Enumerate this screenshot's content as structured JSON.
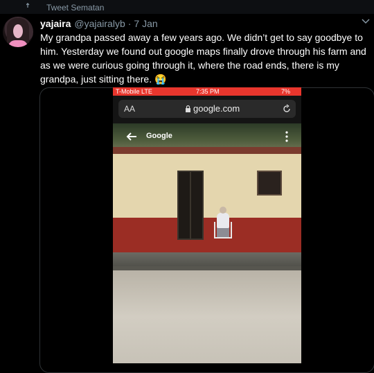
{
  "retweet": {
    "label": "Tweet Sematan"
  },
  "tweet": {
    "name": "yajaira",
    "handle": "@yajairalyb",
    "separator": "·",
    "date": "7 Jan",
    "text": "My grandpa passed away a few years ago. We didn’t get to say goodbye to him. Yesterday we found out google maps finally drove through his farm and as we were curious going through it, where the road ends, there is my grandpa, just sitting there. 😭"
  },
  "media": {
    "status_bar": {
      "carrier": "T-Mobile LTE",
      "time": "7:35 PM",
      "battery": "7%"
    },
    "browser": {
      "reader_label": "AA",
      "url": "google.com"
    },
    "streetview": {
      "logo": "Google"
    }
  },
  "colors": {
    "background": "#000000",
    "status_red": "#e8362d",
    "muted": "#8899a6"
  },
  "icons": [
    "retweet-icon",
    "chevron-down-icon",
    "lock-icon",
    "reload-icon",
    "back-arrow-icon",
    "more-vertical-icon"
  ]
}
